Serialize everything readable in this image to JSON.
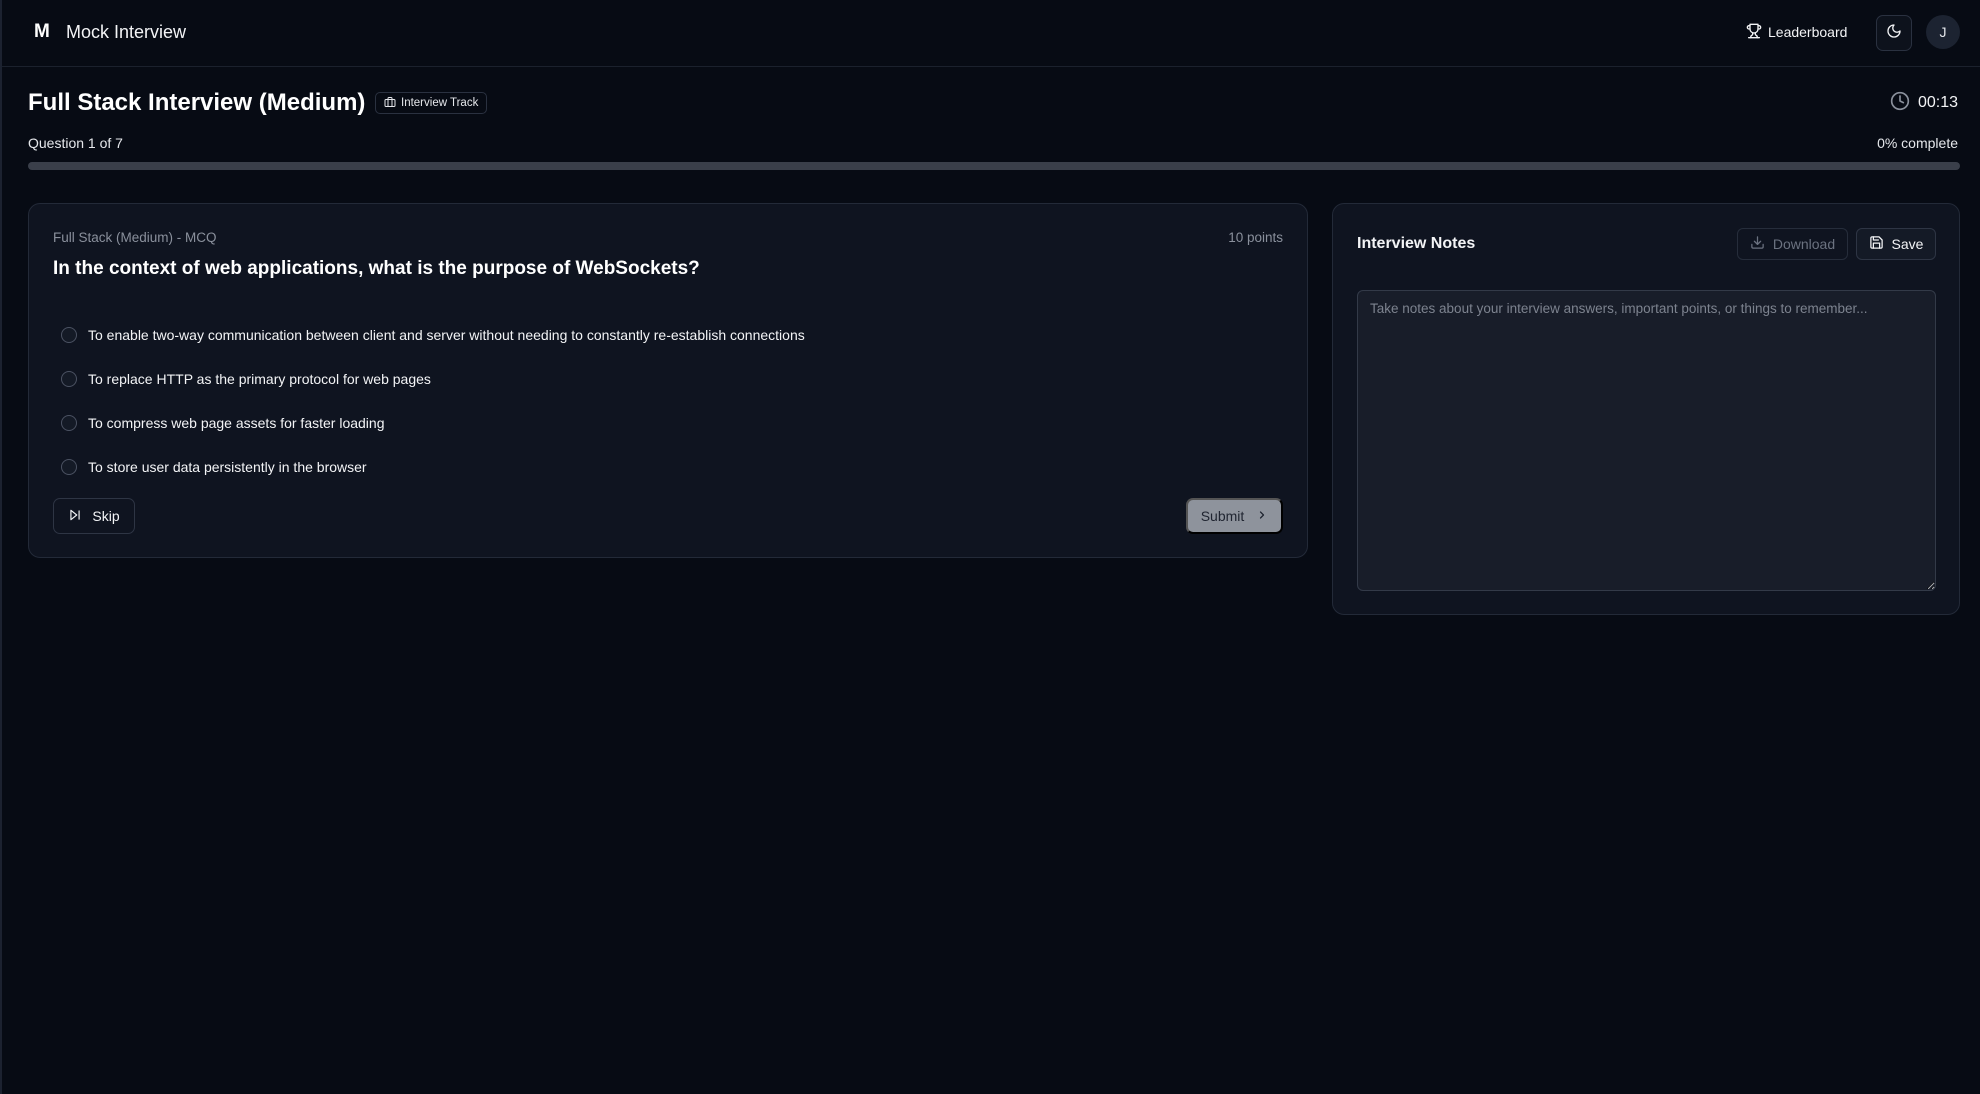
{
  "header": {
    "logo": "M",
    "app_title": "Mock Interview",
    "leaderboard_label": "Leaderboard",
    "avatar_initial": "J"
  },
  "page": {
    "title": "Full Stack Interview (Medium)",
    "track_badge": "Interview Track",
    "timer": "00:13",
    "question_count": "Question 1 of 7",
    "percent_label": "0% complete",
    "progress_fraction": 0
  },
  "question": {
    "meta": "Full Stack (Medium) - MCQ",
    "points": "10 points",
    "text": "In the context of web applications, what is the purpose of WebSockets?",
    "options": [
      "To enable two-way communication between client and server without needing to constantly re-establish connections",
      "To replace HTTP as the primary protocol for web pages",
      "To compress web page assets for faster loading",
      "To store user data persistently in the browser"
    ],
    "skip_label": "Skip",
    "submit_label": "Submit"
  },
  "notes": {
    "title": "Interview Notes",
    "download_label": "Download",
    "save_label": "Save",
    "placeholder": "Take notes about your interview answers, important points, or things to remember...",
    "value": ""
  },
  "colors": {
    "background": "#070b14",
    "card": "#0f1420",
    "submit_disabled": "#8e939c"
  }
}
